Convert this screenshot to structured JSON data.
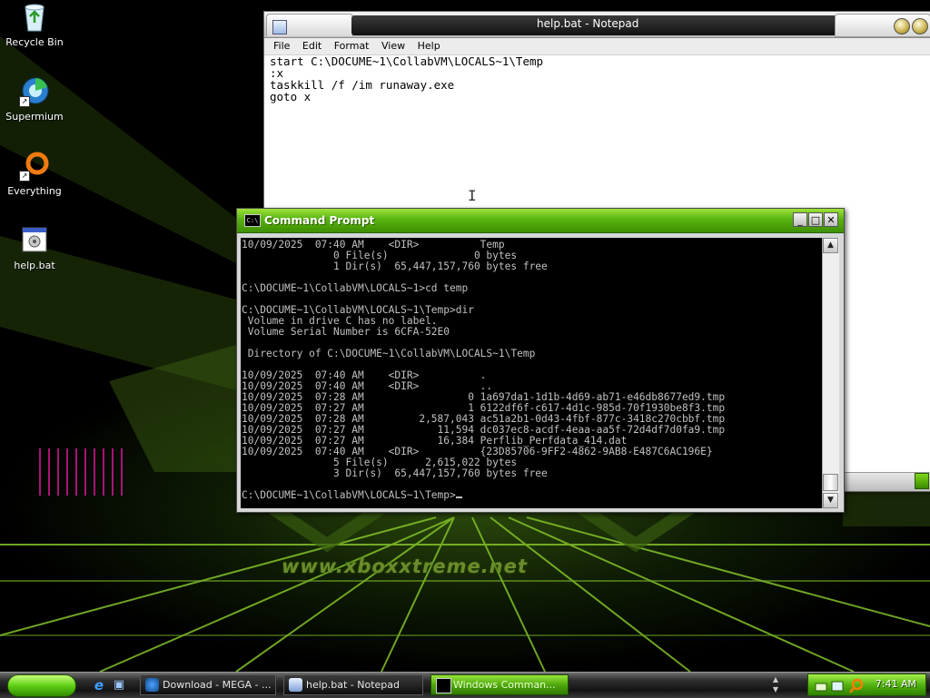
{
  "desktop": {
    "watermark": "www.xboxxtreme.net",
    "icons": [
      {
        "label": "Recycle Bin",
        "icon": "recycle-bin-icon"
      },
      {
        "label": "Supermium",
        "icon": "supermium-browser-icon"
      },
      {
        "label": "Everything",
        "icon": "everything-search-icon"
      },
      {
        "label": "help.bat",
        "icon": "batch-file-icon"
      }
    ]
  },
  "notepad": {
    "title": "help.bat - Notepad",
    "menu": [
      "File",
      "Edit",
      "Format",
      "View",
      "Help"
    ],
    "lines": [
      "start C:\\DOCUME~1\\CollabVM\\LOCALS~1\\Temp",
      ":x",
      "taskkill /f /im runaway.exe",
      "goto x"
    ]
  },
  "cmd": {
    "title": "Command Prompt",
    "lines": [
      "10/09/2025  07:40 AM    <DIR>          Temp",
      "               0 File(s)              0 bytes",
      "               1 Dir(s)  65,447,157,760 bytes free",
      "",
      "C:\\DOCUME~1\\CollabVM\\LOCALS~1>cd temp",
      "",
      "C:\\DOCUME~1\\CollabVM\\LOCALS~1\\Temp>dir",
      " Volume in drive C has no label.",
      " Volume Serial Number is 6CFA-52E0",
      "",
      " Directory of C:\\DOCUME~1\\CollabVM\\LOCALS~1\\Temp",
      "",
      "10/09/2025  07:40 AM    <DIR>          .",
      "10/09/2025  07:40 AM    <DIR>          ..",
      "10/09/2025  07:28 AM                 0 1a697da1-1d1b-4d69-ab71-e46db8677ed9.tmp",
      "10/09/2025  07:27 AM                 1 6122df6f-c617-4d1c-985d-70f1930be8f3.tmp",
      "10/09/2025  07:28 AM         2,587,043 ac51a2b1-0d43-4fbf-877c-3418c270cbbf.tmp",
      "10/09/2025  07:27 AM            11,594 dc037ec8-acdf-4eaa-aa5f-72d4df7d0fa9.tmp",
      "10/09/2025  07:27 AM            16,384 Perflib_Perfdata_414.dat",
      "10/09/2025  07:40 AM    <DIR>          {23D85706-9FF2-4862-9AB8-E487C6AC196E}",
      "               5 File(s)      2,615,022 bytes",
      "               3 Dir(s)  65,447,157,760 bytes free",
      ""
    ],
    "prompt": "C:\\DOCUME~1\\CollabVM\\LOCALS~1\\Temp>",
    "buttons": {
      "minimize": "_",
      "maximize": "□",
      "close": "✕"
    }
  },
  "taskbar": {
    "quick_launch": [
      {
        "icon": "internet-explorer-icon",
        "glyph": "e"
      },
      {
        "icon": "show-desktop-icon",
        "glyph": "▣"
      }
    ],
    "tasks": [
      {
        "label": "Download - MEGA - ...",
        "active": false
      },
      {
        "label": "help.bat - Notepad",
        "active": false
      },
      {
        "label": "Windows Comman...",
        "active": true
      }
    ],
    "clock": "7:41 AM"
  },
  "colors": {
    "accent_green": "#58b310",
    "console_bg": "#000000",
    "console_fg": "#c0c0c0"
  }
}
